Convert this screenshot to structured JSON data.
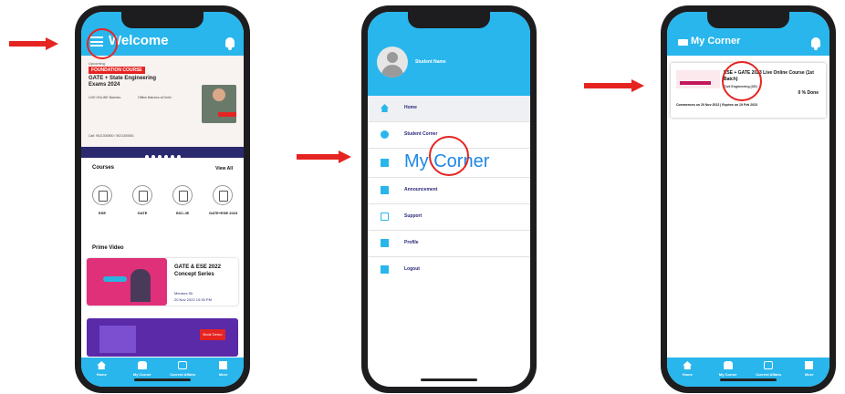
{
  "screens": {
    "home": {
      "title": "Welcome",
      "banner": {
        "line1": "Upcoming",
        "tag": "FOUNDATION COURSE",
        "headline": "GATE + State Engineering Exams 2024",
        "col1": "LIVE ONLINE Batches",
        "col2": "Offline Batches at Delhi",
        "footer": "Call: 9021300500 / 9021300501"
      },
      "courses_title": "Courses",
      "view_all": "View All",
      "courses": [
        "ESE",
        "GATE",
        "SSC-JE",
        "GATE+ESE 2023"
      ],
      "prime_title": "Prime Video",
      "prime_card": {
        "title": "GATE & ESE 2022 Concept Series",
        "author": "Mentors Sir",
        "date": "20 Nov 2022  10:30 PM"
      },
      "promo_button": "Book Demo",
      "nav": [
        "Home",
        "My Corner",
        "Current Affairs",
        "More"
      ]
    },
    "drawer": {
      "student_name": "Student Name",
      "menu": [
        "Home",
        "Student Corner",
        "My Corner",
        "Announcement",
        "Support",
        "Profile",
        "Logout"
      ]
    },
    "corner": {
      "title": "My Corner",
      "card": {
        "title": "ESE + GATE 2023 Live Online Course (1st Batch)",
        "subtitle": "Civil Engineering (CE)",
        "progress": "0 % Done",
        "dates": "Commences on 20 Nov 2022  |  Expires on 19 Feb 2023"
      },
      "nav": [
        "Home",
        "My Corner",
        "Current Affairs",
        "More"
      ]
    }
  }
}
